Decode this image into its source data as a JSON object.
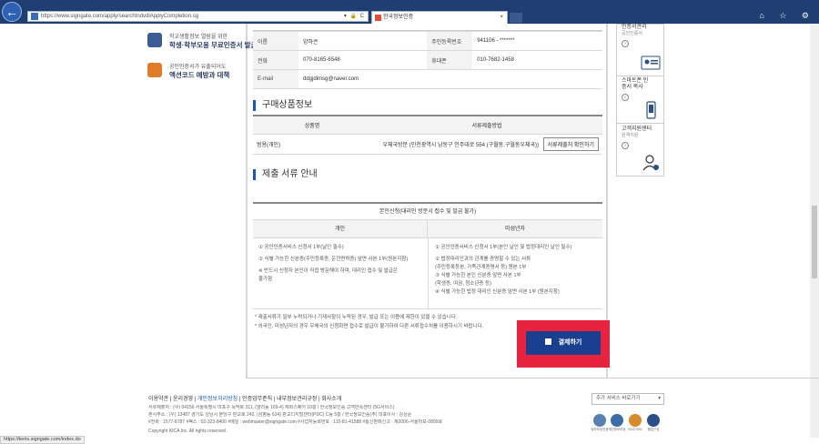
{
  "browser": {
    "url": "https://www.signgate.com/apply/searchIndvdlApplyCompletion.sg",
    "tab_title": "한국정보인증",
    "tab_close": "×",
    "addr_controls": "▾ 🔒 C",
    "window_controls": "⌂ ☆ ⚙"
  },
  "left_ads": [
    {
      "line1": "학교생활정보 열람을 위한",
      "line2": "학생·학부모용 무료인증서 발급"
    },
    {
      "line1": "공인인증서가 유출되어도",
      "line2": "액션코드 예방과 대책"
    }
  ],
  "applicant": {
    "rows": [
      {
        "label1": "이름",
        "value1": "양하은",
        "label2": "주민등록번호",
        "value2": "941106 - *******"
      },
      {
        "label1": "전화",
        "value1": "070-8165-6548",
        "label2": "휴대폰",
        "value2": "010-7682-1458"
      },
      {
        "label1": "E-mail",
        "value1": "ddgjdlmsg@naver.com",
        "label2": "",
        "value2": ""
      }
    ]
  },
  "purchase": {
    "title": "구매상품정보",
    "col_product": "상품명",
    "col_method": "서류제출방법",
    "product": "범용(개인)",
    "method": "우체국방문 (인천광역시 남동구 인주대로 554 (구월동,구월동우체국))",
    "button": "서류제출처 확인하기"
  },
  "docs": {
    "title": "제출 서류 안내",
    "caption": "본인신청(대리인 방문시 접수 및 발급 불가)",
    "col_personal": "개인",
    "col_minor": "미성년자",
    "personal_lines": [
      "① 공인인증서비스 신청서 1부(날인 필수)",
      "② 식별 가능한 신분증(주민등록증, 운전면허증) 앞면 사본 1부(원본지참)",
      "※ 반드시 신청자 본인이 직접 방문해야 하며, 대리인 접수 및 발급은",
      "불가함"
    ],
    "minor_lines": [
      "① 공인인증서비스 신청서 1부(본인 날인 및 법정대리인 날인 필수)",
      "② 법정대리인과의 관계를 증명할 수 있는 서류",
      "(주민등록등본, 가족관계증명서 등) 원본 1부",
      "③ 식별 가능한 본인 신분증 앞면 사본 1부",
      "(학생증, 여권, 청소년증 등)",
      "④ 식별 가능한 법정 대리인 신분증 앞면 사본 1부 (원본지참)"
    ]
  },
  "notes": [
    "* 제출서류가 일부 누락되거나 기재사항이 누락된 경우, 발급 또는 이용에 제한이 있을 수 있습니다.",
    "* 외국인, 미성년자의 경우 우체국의 신청화면 접수로 발급이 불가하여 다른 서류접수처를 이용하시기 바랍니다."
  ],
  "pay_button": "결제하기",
  "sidebar": [
    {
      "title": "인증서관리",
      "sub": "공인인증서",
      "arrow": "›"
    },
    {
      "title": "스마트폰 인증서 복사",
      "sub": "",
      "arrow": "›"
    },
    {
      "title": "고객지원센터",
      "sub": "원격지원",
      "arrow": "›"
    }
  ],
  "footer": {
    "links": [
      "이용약관",
      "윤리경영",
      "개인정보처리방침",
      "인증업무준칙",
      "내부정보관리규정",
      "회사소개"
    ],
    "sep": " | ",
    "addr1": "서류제출처 : (우) 04156 서울특별시 마포구 독막로 311, (염리동 169-4) 재화스퀘어 10층 / 한국정보인증 고객만족센터 (5G서비스)",
    "addr2": "본사주소 : (우) 13487 경기도 성남시 분당구 판교로 242, (삼평동 624) 판교디지털센터(PDC) C동 5층 / 한국정보인증(주) 대표이사 : 김상준",
    "addr3": "#전화 : 1577-8787  #팩스 : 02-323-8400  #메일 : webmaster@signgate.com  #사업자등록번호 : 110-81-41588  #통신판매신고 : 제2006-서울마포-0899호",
    "copyright": "Copyright KICA Inc. All rights reserved.",
    "select": "주가 서비스 바로가기",
    "select_arrow": "▾",
    "badges": [
      "정보보호인증",
      "개인정보보호",
      "ISO27001",
      "웹접근성"
    ]
  },
  "statusbar": "https://keris.signgate.com/index.do",
  "colors": {
    "accent": "#1b58b5",
    "pay_button": "#1b3f8f",
    "highlight": "#e8233f",
    "chrome": "#1f3f73"
  }
}
